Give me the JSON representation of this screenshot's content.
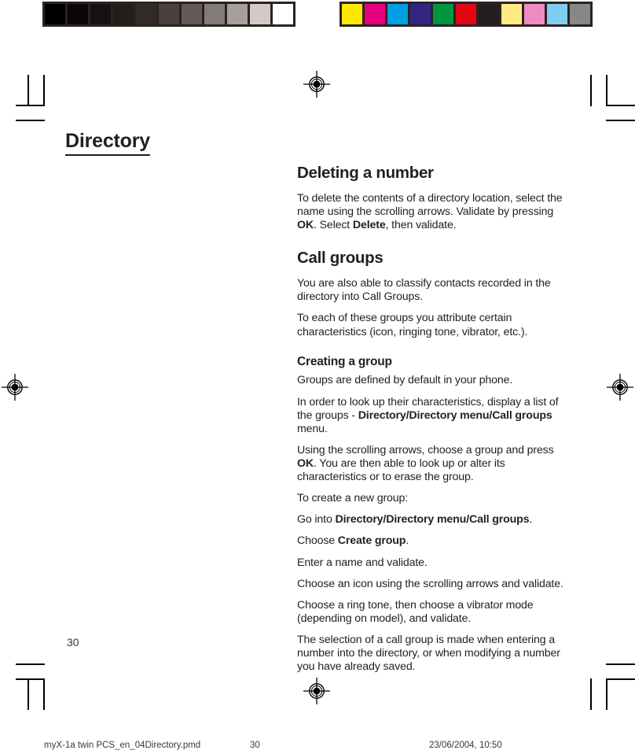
{
  "document": {
    "chapter_title": "Directory",
    "page_number": "30"
  },
  "calibration": {
    "grayscale_label": "grayscale-calibration-strip",
    "color_label": "color-calibration-strip",
    "grayscale_swatches": [
      "#000000",
      "#0b0707",
      "#161110",
      "#231d1c",
      "#332b2a",
      "#4a403e",
      "#645a57",
      "#837b78",
      "#a79f9c",
      "#d3c9c6",
      "#ffffff"
    ],
    "color_swatches": [
      "#fde800",
      "#e6007e",
      "#009fe3",
      "#312783",
      "#009640",
      "#e30613",
      "#231f20",
      "#fdea80",
      "#ef8ac2",
      "#7fcdf0",
      "#878787"
    ]
  },
  "content": {
    "sections": [
      {
        "id": "deleting-a-number",
        "heading": "Deleting a number",
        "heading_level": "h2",
        "paragraphs": [
          "To delete the contents of a directory location, select the name using the scrolling arrows. Validate by pressing OK. Select Delete, then validate."
        ]
      },
      {
        "id": "call-groups",
        "heading": "Call groups",
        "heading_level": "h2",
        "paragraphs": [
          "You are also able to classify contacts recorded in the directory into Call Groups.",
          "To each of these groups you attribute certain characteristics (icon, ringing tone, vibrator, etc.)."
        ]
      },
      {
        "id": "creating-a-group",
        "heading": "Creating a group",
        "heading_level": "h3",
        "paragraphs": [
          "Groups are defined by default in your phone.",
          "In order to look up their characteristics, display a list of the groups - Directory/Directory menu/Call groups menu.",
          "Using the scrolling arrows, choose a group and press OK. You are then able to look up or alter its characteristics or to erase the group.",
          "To create a new group:",
          "Go into Directory/Directory menu/Call groups.",
          "Choose Create group.",
          "Enter a name and validate.",
          "Choose an icon using the scrolling arrows and validate.",
          "Choose a ring tone, then choose a vibrator mode (depending on model), and validate.",
          "The selection of a call group is made when entering a number into the directory, or when modifying a number you have already saved."
        ]
      }
    ],
    "paragraph_runs": {
      "p_delete": [
        {
          "t": "To delete the contents of a directory location, select the name using the scrolling arrows. Validate by pressing ",
          "b": false
        },
        {
          "t": "OK",
          "b": true
        },
        {
          "t": ". Select ",
          "b": false
        },
        {
          "t": "Delete",
          "b": true
        },
        {
          "t": ", then validate.",
          "b": false
        }
      ],
      "p_classify": [
        {
          "t": "You are also able to classify contacts recorded in the directory into Call Groups.",
          "b": false
        }
      ],
      "p_characteristics": [
        {
          "t": "To each of these groups you attribute certain characteristics (icon, ringing tone, vibrator, etc.).",
          "b": false
        }
      ],
      "p_default_groups": [
        {
          "t": "Groups are defined by default in your phone.",
          "b": false
        }
      ],
      "p_lookup": [
        {
          "t": "In order to look up their characteristics, display a list of the groups - ",
          "b": false
        },
        {
          "t": "Directory/Directory menu/Call groups",
          "b": true
        },
        {
          "t": " menu.",
          "b": false
        }
      ],
      "p_scrolling": [
        {
          "t": "Using the scrolling arrows, choose a group and press ",
          "b": false
        },
        {
          "t": "OK",
          "b": true
        },
        {
          "t": ". You are then able to look up or alter its characteristics or to erase the group.",
          "b": false
        }
      ],
      "p_create_new": [
        {
          "t": "To create a new group:",
          "b": false
        }
      ],
      "p_go_into": [
        {
          "t": "Go into ",
          "b": false
        },
        {
          "t": "Directory/Directory menu/Call groups",
          "b": true
        },
        {
          "t": ".",
          "b": false
        }
      ],
      "p_choose_create": [
        {
          "t": "Choose ",
          "b": false
        },
        {
          "t": "Create group",
          "b": true
        },
        {
          "t": ".",
          "b": false
        }
      ],
      "p_enter_name": [
        {
          "t": "Enter a name and validate.",
          "b": false
        }
      ],
      "p_choose_icon": [
        {
          "t": "Choose an icon using the scrolling arrows and validate.",
          "b": false
        }
      ],
      "p_ring_tone": [
        {
          "t": "Choose a ring tone, then choose a vibrator mode (depending on model), and validate.",
          "b": false
        }
      ],
      "p_selection": [
        {
          "t": "The selection of a call group is made when entering a number into the directory, or when modifying a number you have already saved.",
          "b": false
        }
      ]
    }
  },
  "footer": {
    "file_name": "myX-1a twin PCS_en_04Directory.pmd",
    "page": "30",
    "timestamp": "23/06/2004, 10:50"
  },
  "print_marks": {
    "registration_icon": "registration-target-icon",
    "crop_icon": "crop-mark-line"
  }
}
